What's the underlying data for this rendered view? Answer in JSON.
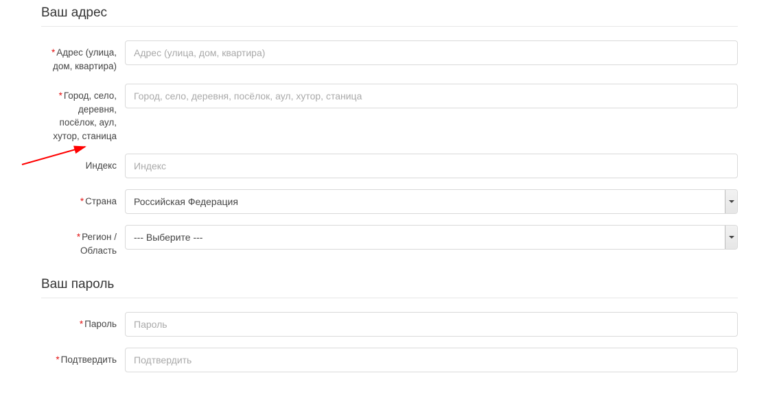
{
  "sections": {
    "address": {
      "title": "Ваш адрес",
      "fields": {
        "address": {
          "label": "Адрес (улица, дом, квартира)",
          "placeholder": "Адрес (улица, дом, квартира)",
          "required": true,
          "value": ""
        },
        "city": {
          "label": "Город, село, деревня, посёлок, аул, хутор, станица",
          "placeholder": "Город, село, деревня, посёлок, аул, хутор, станица",
          "required": true,
          "value": ""
        },
        "postcode": {
          "label": "Индекс",
          "placeholder": "Индекс",
          "required": false,
          "value": ""
        },
        "country": {
          "label": "Страна",
          "selected": "Российская Федерация",
          "required": true
        },
        "region": {
          "label": "Регион / Область",
          "selected": " --- Выберите --- ",
          "required": true
        }
      }
    },
    "password": {
      "title": "Ваш пароль",
      "fields": {
        "password": {
          "label": "Пароль",
          "placeholder": "Пароль",
          "required": true,
          "value": ""
        },
        "confirm": {
          "label": "Подтвердить",
          "placeholder": "Подтвердить",
          "required": true,
          "value": ""
        }
      }
    }
  },
  "required_marker": "*"
}
